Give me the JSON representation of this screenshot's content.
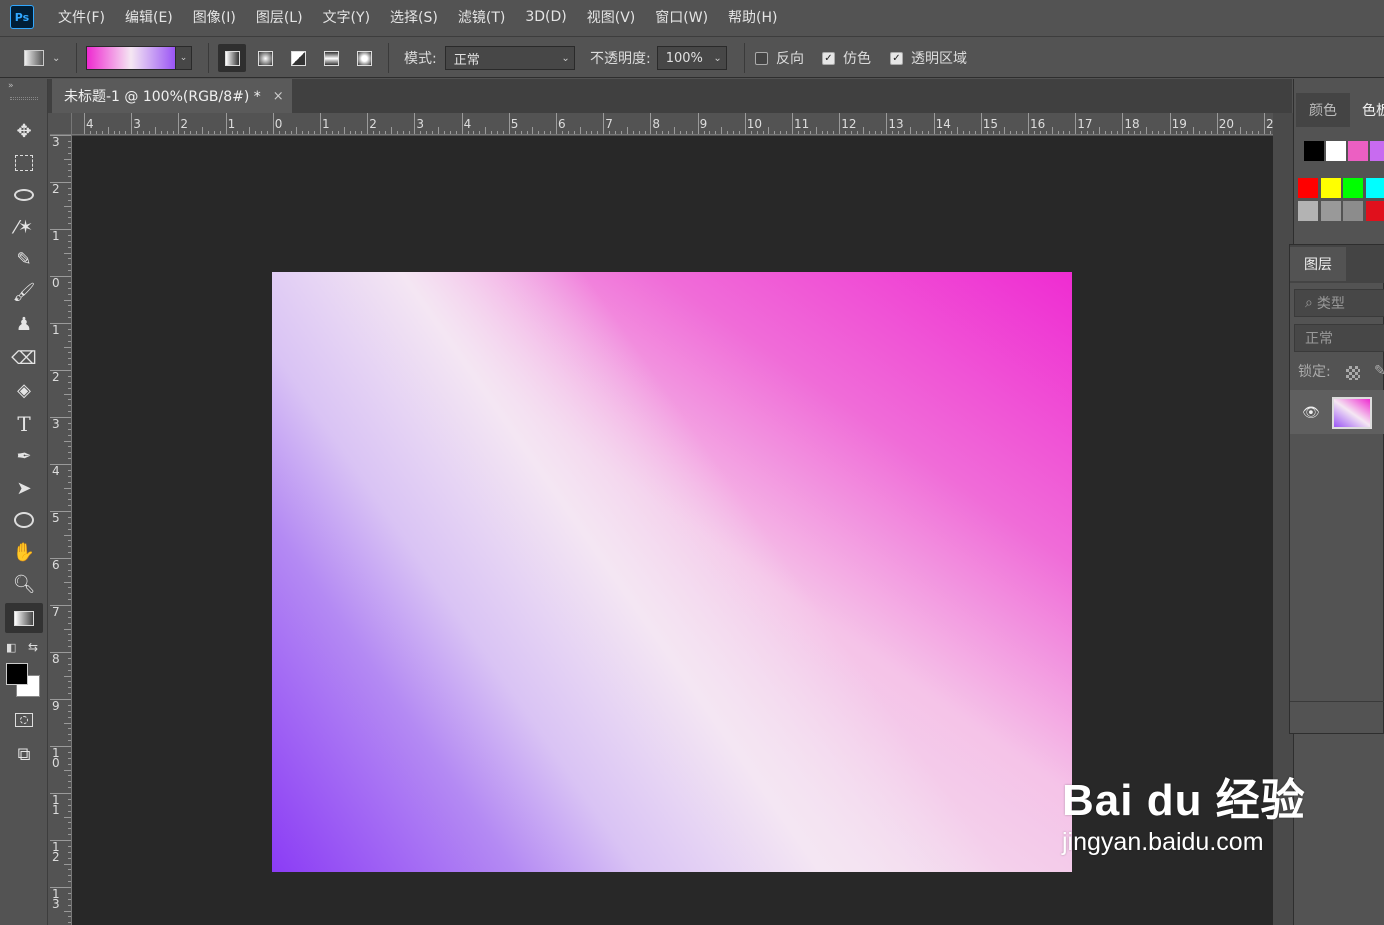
{
  "app": {
    "logo_text": "Ps"
  },
  "menu": [
    "文件(F)",
    "编辑(E)",
    "图像(I)",
    "图层(L)",
    "文字(Y)",
    "选择(S)",
    "滤镜(T)",
    "3D(D)",
    "视图(V)",
    "窗口(W)",
    "帮助(H)"
  ],
  "options": {
    "mode_label": "模式:",
    "mode_value": "正常",
    "opacity_label": "不透明度:",
    "opacity_value": "100%",
    "reverse_label": "反向",
    "reverse_checked": false,
    "dither_label": "仿色",
    "dither_checked": true,
    "transparency_label": "透明区域",
    "transparency_checked": true,
    "gradient_colors": [
      "#ee2ad0",
      "#f5e7f3",
      "#9a55f5"
    ]
  },
  "document": {
    "tab_title": "未标题-1 @ 100%(RGB/8#) *",
    "close": "×"
  },
  "rulers": {
    "top_labels": [
      "4",
      "3",
      "2",
      "1",
      "0",
      "1",
      "2",
      "3",
      "4",
      "5",
      "6",
      "7",
      "8",
      "9",
      "10",
      "11",
      "12",
      "13",
      "14",
      "15",
      "16",
      "17",
      "18",
      "19",
      "20",
      "2"
    ],
    "left_labels": [
      "3",
      "2",
      "1",
      "0",
      "1",
      "2",
      "3",
      "4",
      "5",
      "6",
      "7",
      "8",
      "9",
      "1 0",
      "1 1",
      "1 2",
      "1 3"
    ]
  },
  "panels": {
    "color_tab": "颜色",
    "swatches_tab": "色板",
    "swatches": [
      "#000000",
      "#ffffff",
      "#ec5fc2",
      "#c86bf0",
      "#ff0000",
      "#ffff00",
      "#00ff00",
      "#00ffff",
      "#b3b3b3",
      "#999999",
      "#8c8c8c",
      "#e0101c"
    ],
    "layers_tab": "图层",
    "search_placeholder": "类型",
    "blend_mode": "正常",
    "lock_label": "锁定:"
  },
  "watermark": {
    "logo": "Bai du 经验",
    "url": "jingyan.baidu.com"
  }
}
